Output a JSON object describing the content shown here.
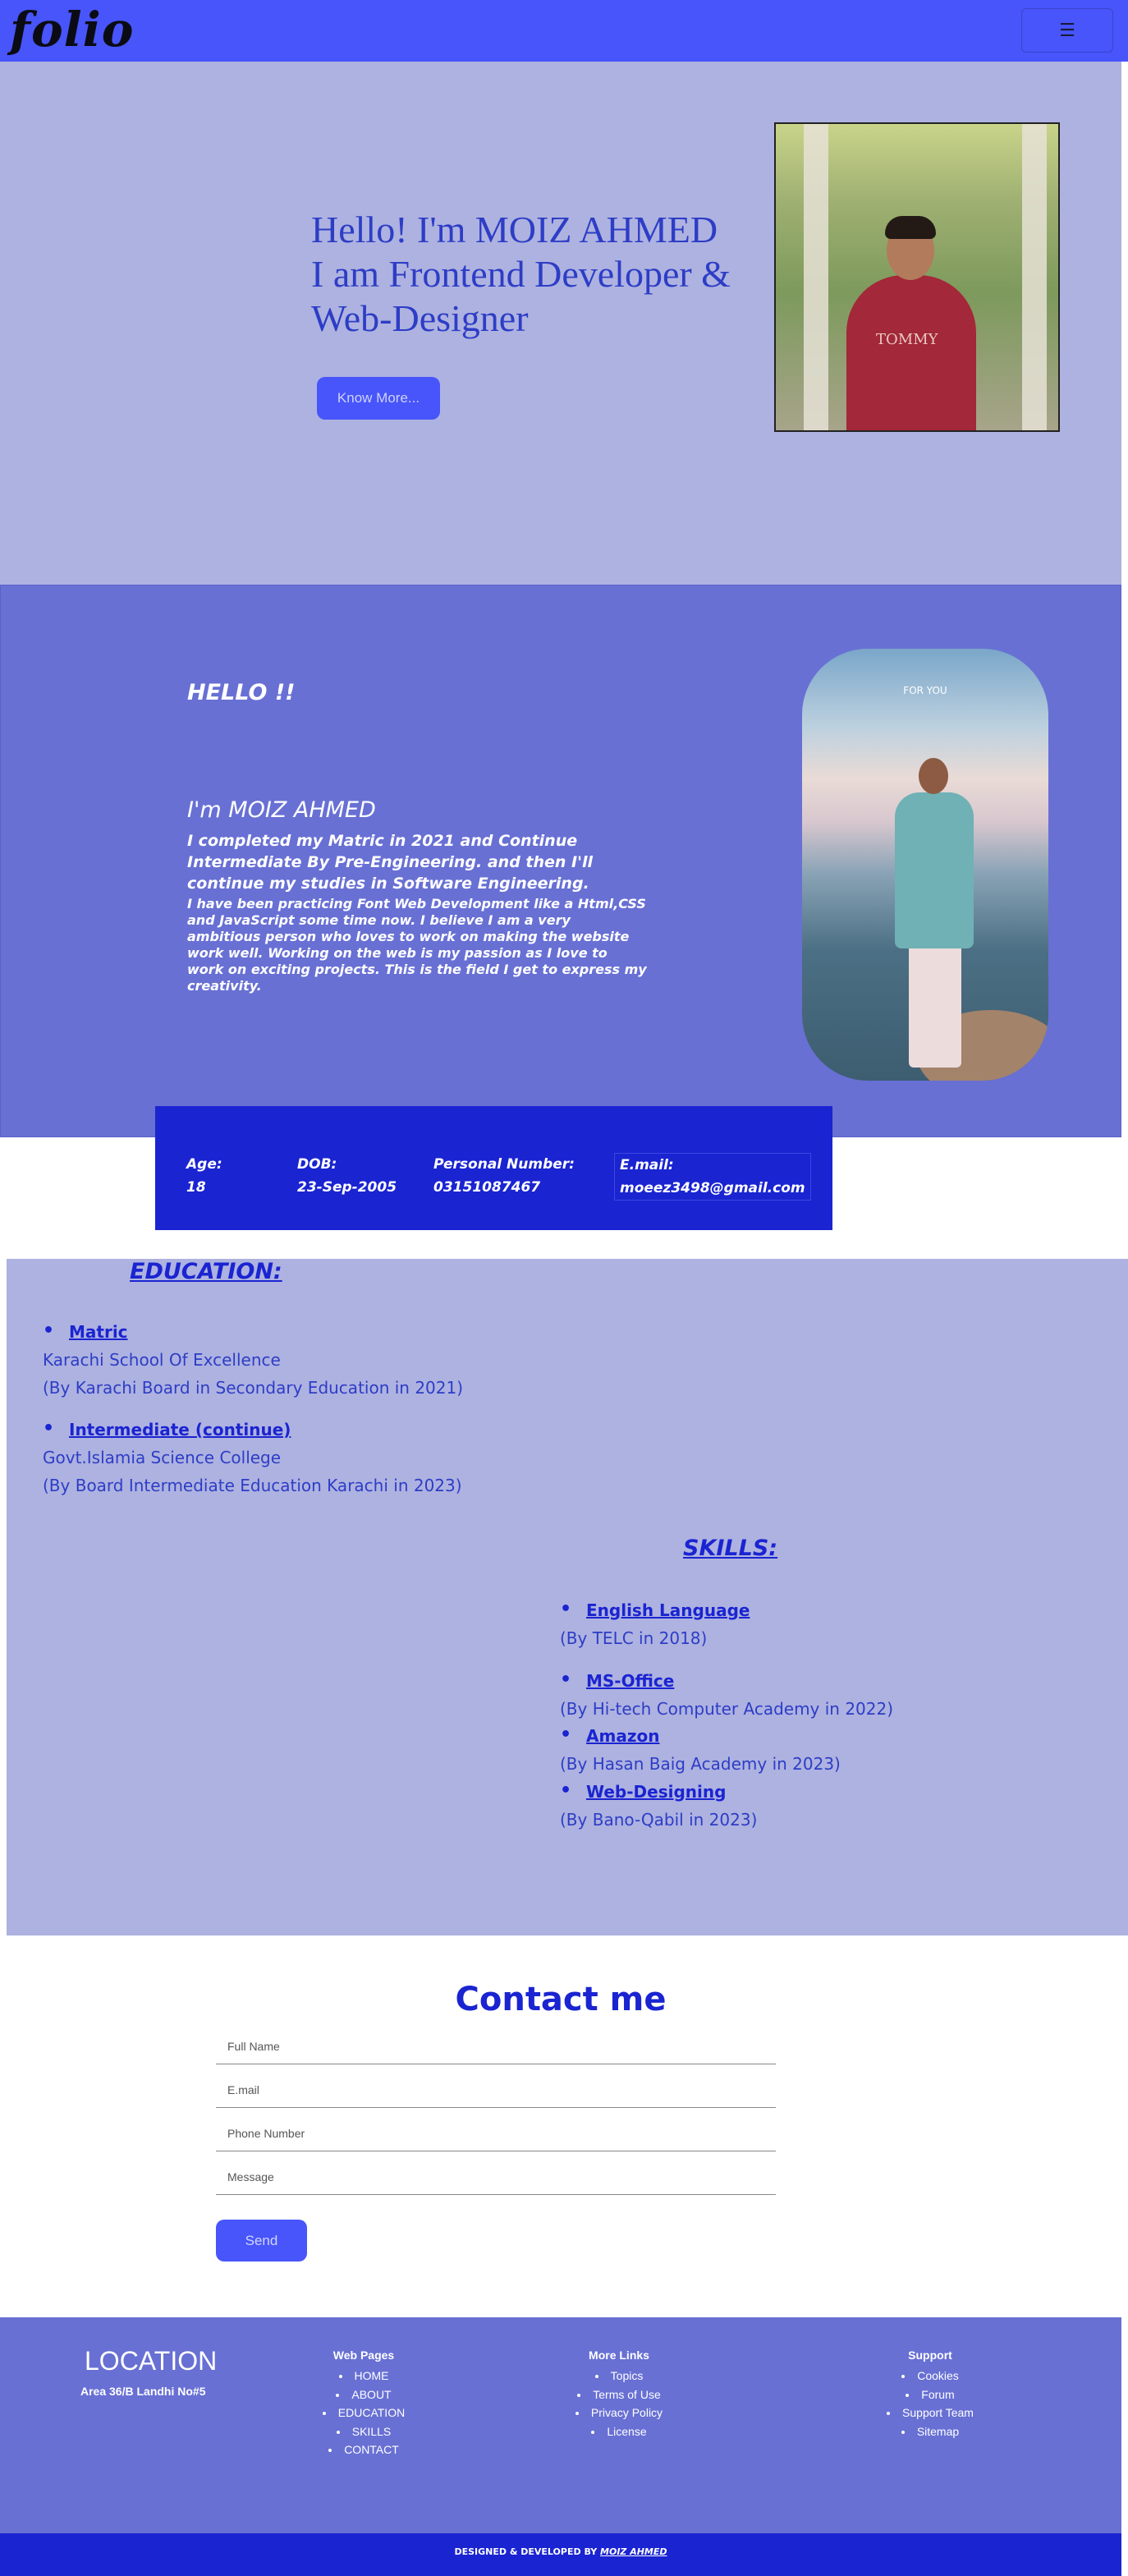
{
  "navbar": {
    "logo": "folio",
    "menu_icon": "hamburger-icon",
    "menu_glyph": "☰"
  },
  "hero": {
    "line1": "Hello! I'm MOIZ AHMED",
    "line2": "I am Frontend Developer &",
    "line3": "Web-Designer",
    "button": "Know More...",
    "photo_text": "TOMMY"
  },
  "about": {
    "hello": "HELLO !!",
    "name": "I'm MOIZ AHMED",
    "para1": "I completed my Matric in 2021 and Continue Intermediate By Pre-Engineering. and then I'll continue my studies in Software Engineering.",
    "para2": "I have been practicing Font Web Development like a Html,CSS and JavaScript some time now. I believe I am a very ambitious person who loves to work on making the website work well. Working on the web is my passion as I love to work on exciting projects. This is the field I get to express my creativity.",
    "photo_text": "FOR YOU"
  },
  "info": {
    "age_label": "Age:",
    "age_value": "18",
    "dob_label": "DOB:",
    "dob_value": "23-Sep-2005",
    "phone_label": "Personal Number:",
    "phone_value": "03151087467",
    "email_label": "E.mail:",
    "email_value": "moeez3498@gmail.com"
  },
  "education": {
    "title": "EDUCATION:",
    "items": [
      {
        "title": "Matric",
        "line1": "Karachi School Of Excellence",
        "line2": "(By Karachi Board in Secondary Education in 2021)"
      },
      {
        "title": "Intermediate (continue)",
        "line1": "Govt.Islamia Science College",
        "line2": "(By Board Intermediate Education Karachi in 2023)"
      }
    ]
  },
  "skills": {
    "title": "SKILLS:",
    "items": [
      {
        "title": "English Language",
        "line": "(By TELC in 2018)"
      },
      {
        "title": "MS-Office",
        "line": "(By Hi-tech Computer Academy in 2022)"
      },
      {
        "title": "Amazon",
        "line": "(By Hasan Baig Academy in 2023)"
      },
      {
        "title": "Web-Designing",
        "line": "(By Bano-Qabil in 2023)"
      }
    ]
  },
  "contact": {
    "title": "Contact me",
    "full_name_placeholder": "Full Name",
    "email_placeholder": "E.mail",
    "phone_placeholder": "Phone Number",
    "message_placeholder": "Message",
    "send": "Send"
  },
  "footer": {
    "location_title": "LOCATION",
    "address": "Area 36/B Landhi No#5",
    "web_pages": {
      "title": "Web Pages",
      "items": [
        "HOME",
        "ABOUT",
        "EDUCATION",
        "SKILLS",
        "CONTACT"
      ]
    },
    "more_links": {
      "title": "More Links",
      "items": [
        "Topics",
        "Terms of Use",
        "Privacy Policy",
        "License"
      ]
    },
    "support": {
      "title": "Support",
      "items": [
        "Cookies",
        "Forum",
        "Support Team",
        "Sitemap"
      ]
    },
    "credit_prefix": "DESIGNED & DEVELOPED BY ",
    "credit_author": "MOIZ AHMED"
  },
  "colors": {
    "primary": "#4755fa",
    "hero_bg": "#aeb2e0",
    "about_bg": "#6870d4",
    "accent_dark": "#1a24d1"
  }
}
